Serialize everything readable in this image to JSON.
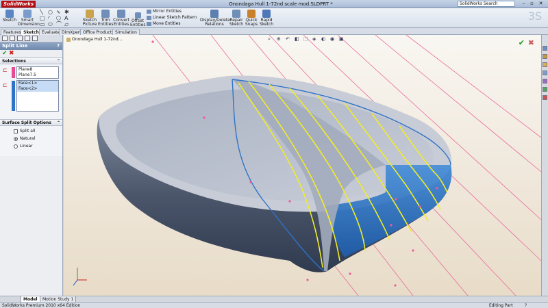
{
  "app": {
    "logo": "SolidWorks",
    "document_title": "Onondaga Hull 1-72nd scale mod.SLDPRT *",
    "search_placeholder": "SolidWorks Search",
    "brand_color": "#b40d12"
  },
  "ribbon": {
    "sketch": "Sketch",
    "smart_dimension_1": "Smart",
    "smart_dimension_2": "Dimension",
    "sketch_picture_1": "Sketch",
    "sketch_picture_2": "Picture",
    "trim_1": "Trim",
    "trim_2": "Entities",
    "convert_1": "Convert",
    "convert_2": "Entities",
    "offset_1": "Offset",
    "offset_2": "Entities",
    "mirror": "Mirror Entities",
    "linear_pattern": "Linear Sketch Pattern",
    "move": "Move Entities",
    "display_delete_1": "Display/Delete",
    "display_delete_2": "Relations",
    "repair_1": "Repair",
    "repair_2": "Sketch",
    "quick_snaps_1": "Quick",
    "quick_snaps_2": "Snaps",
    "rapid_1": "Rapid",
    "rapid_2": "Sketch"
  },
  "tabs": [
    "Features",
    "Sketch",
    "Evaluate",
    "DimXpert",
    "Office Products",
    "Simulation"
  ],
  "active_tab": "Sketch",
  "property_manager": {
    "title": "Split Line",
    "help": "?",
    "selections": {
      "heading": "Selections",
      "planes": [
        "Plane8",
        "Plane7.5"
      ],
      "faces": [
        "Face<1>",
        "Face<2>"
      ]
    },
    "surface_split": {
      "heading": "Surface Split Options",
      "split_all": "Split all",
      "natural": "Natural",
      "linear": "Linear",
      "selected": "Natural",
      "split_all_checked": false
    }
  },
  "viewport": {
    "tree_root": "Onondaga Hull 1-72nd...",
    "hull_color": "#b4bccb",
    "selected_face_color": "#2f73c8",
    "curve_color": "#f2ec2a",
    "plane_line_color": "#e86a9c"
  },
  "bottom_tabs": [
    "Model",
    "Motion Study 1"
  ],
  "status": {
    "edition": "SolidWorks Premium 2010 x64 Edition",
    "mode": "Editing Part",
    "help": "?"
  }
}
